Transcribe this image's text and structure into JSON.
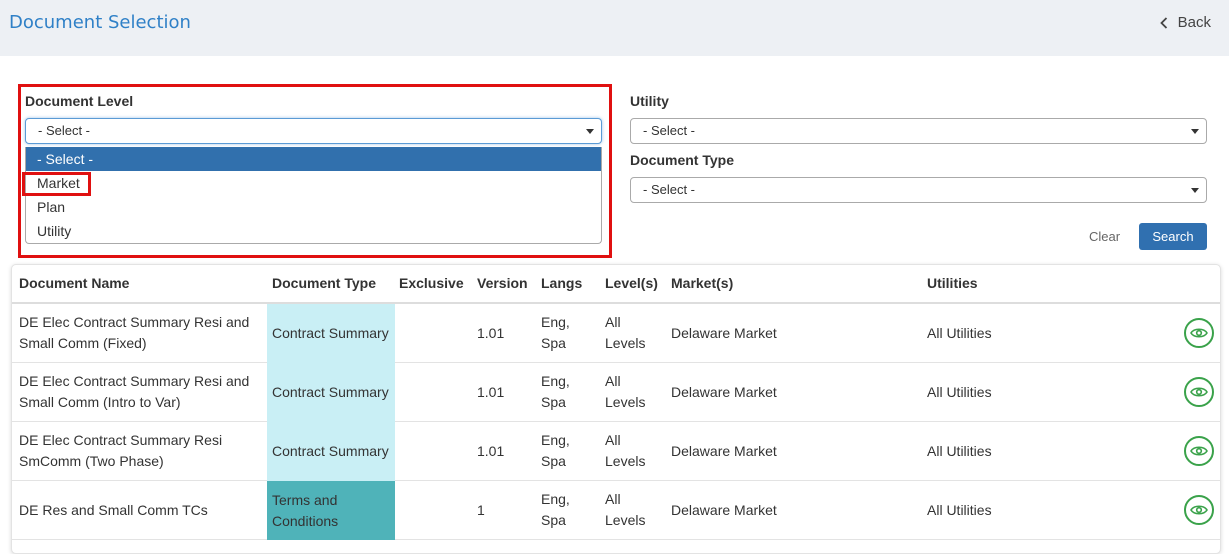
{
  "header": {
    "title": "Document Selection",
    "back_label": "Back"
  },
  "filters": {
    "document_level": {
      "label": "Document Level",
      "value": "- Select -",
      "options": [
        "- Select -",
        "Market",
        "Plan",
        "Utility"
      ]
    },
    "utility": {
      "label": "Utility",
      "value": "- Select -"
    },
    "document_type": {
      "label": "Document Type",
      "value": "- Select -"
    },
    "clear_label": "Clear",
    "search_label": "Search"
  },
  "table": {
    "columns": [
      "Document Name",
      "Document Type",
      "Exclusive",
      "Version",
      "Langs",
      "Level(s)",
      "Market(s)",
      "Utilities"
    ],
    "rows": [
      {
        "name_1": "DE Elec Contract Summary Resi and",
        "name_2": "Small Comm (Fixed)",
        "type_1": "Contract Summary",
        "type_2": "",
        "exclusive": "",
        "version": "1.01",
        "langs_1": "Eng,",
        "langs_2": "Spa",
        "levels_1": "All",
        "levels_2": "Levels",
        "markets": "Delaware Market",
        "utilities": "All Utilities",
        "type_color": "#c9eff5"
      },
      {
        "name_1": "DE Elec Contract Summary Resi and",
        "name_2": "Small Comm (Intro to Var)",
        "type_1": "Contract Summary",
        "type_2": "",
        "exclusive": "",
        "version": "1.01",
        "langs_1": "Eng,",
        "langs_2": "Spa",
        "levels_1": "All",
        "levels_2": "Levels",
        "markets": "Delaware Market",
        "utilities": "All Utilities",
        "type_color": "#c9eff5"
      },
      {
        "name_1": "DE Elec Contract Summary Resi",
        "name_2": "SmComm (Two Phase)",
        "type_1": "Contract Summary",
        "type_2": "",
        "exclusive": "",
        "version": "1.01",
        "langs_1": "Eng,",
        "langs_2": "Spa",
        "levels_1": "All",
        "levels_2": "Levels",
        "markets": "Delaware Market",
        "utilities": "All Utilities",
        "type_color": "#c9eff5"
      },
      {
        "name_1": "DE Res and Small Comm TCs",
        "name_2": "",
        "type_1": "Terms and",
        "type_2": "Conditions",
        "exclusive": "",
        "version": "1",
        "langs_1": "Eng,",
        "langs_2": "Spa",
        "levels_1": "All",
        "levels_2": "Levels",
        "markets": "Delaware Market",
        "utilities": "All Utilities",
        "type_color": "#4fb3b9"
      }
    ]
  },
  "colors": {
    "accent": "#2f80c7",
    "search_button": "#3070b0",
    "highlight": "#e01010",
    "view_icon": "#3aa24a"
  }
}
